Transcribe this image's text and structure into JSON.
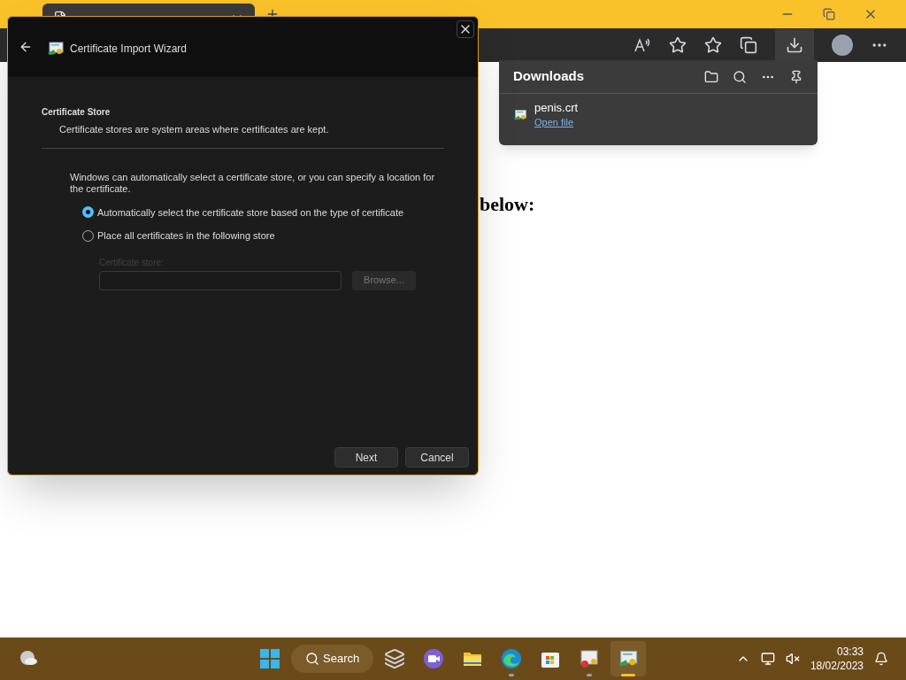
{
  "browser": {
    "page_text": "below:"
  },
  "downloads": {
    "title": "Downloads",
    "items": [
      {
        "name": "penis.crt",
        "action": "Open file"
      }
    ]
  },
  "dialog": {
    "title": "Certificate Import Wizard",
    "heading": "Certificate Store",
    "subheading": "Certificate stores are system areas where certificates are kept.",
    "description": "Windows can automatically select a certificate store, or you can specify a location for the certificate.",
    "options": [
      {
        "label": "Automatically select the certificate store based on the type of certificate",
        "selected": true
      },
      {
        "label": "Place all certificates in the following store",
        "selected": false
      }
    ],
    "store_field": {
      "label": "Certificate store:",
      "disabled": true
    },
    "browse": {
      "label": "Browse...",
      "disabled": true
    },
    "buttons": [
      "Next",
      "Cancel"
    ]
  },
  "taskbar": {
    "search": "Search",
    "apps": [
      {
        "kind": "task-view",
        "running": false,
        "active": false
      },
      {
        "kind": "chat",
        "running": false,
        "active": false
      },
      {
        "kind": "explorer",
        "running": false,
        "active": false
      },
      {
        "kind": "edge",
        "running": true,
        "active": false
      },
      {
        "kind": "store",
        "running": false,
        "active": false
      },
      {
        "kind": "certificate",
        "running": true,
        "active": false
      },
      {
        "kind": "wizard",
        "running": true,
        "active": true
      }
    ],
    "time": "03:33",
    "date": "18/02/2023"
  }
}
